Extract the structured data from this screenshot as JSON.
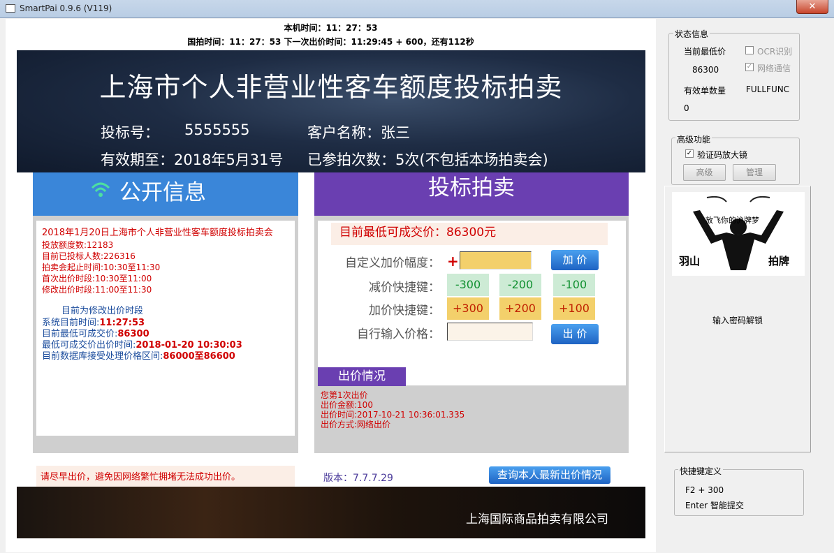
{
  "window": {
    "title": "SmartPai 0.9.6 (V119)",
    "close_label": "✕"
  },
  "header": {
    "local_time": "本机时间：11：27：53",
    "auction_time": "国拍时间：11：27：53 下一次出价时间：11:29:45 + 600，还有112秒"
  },
  "banner": {
    "title": "上海市个人非营业性客车额度投标拍卖",
    "bid_no_label": "投标号：",
    "bid_no": "5555555",
    "customer": "客户名称：张三",
    "valid_until": "有效期至：2018年5月31号",
    "participated": "已参拍次数：5次(不包括本场拍卖会)"
  },
  "public_info": {
    "title": "公开信息",
    "lines_red": [
      "2018年1月20日上海市个人非营业性客车额度投标拍卖会",
      "投放额度数:12183",
      "目前已投标人数:226316",
      "拍卖会起止时间:10:30至11:30",
      "首次出价时段:10:30至11:00",
      "修改出价时段:11:00至11:30"
    ],
    "phase": "目前为修改出价时段",
    "sys_time_label": "系统目前时间:",
    "sys_time": "11:27:53",
    "lowest_label": "目前最低可成交价:",
    "lowest": "86300",
    "lowest_time_label": "最低可成交价出价时间:",
    "lowest_time": "2018-01-20 10:30:03",
    "range_label": "目前数据库接受处理价格区间:",
    "range": "86000至86600",
    "warning": "请尽早出价，避免因网络繁忙拥堵无法成功出价。"
  },
  "bidding": {
    "title": "投标拍卖",
    "lowest_price": "目前最低可成交价：86300元",
    "custom_increase_label": "自定义加价幅度：",
    "plus_sign": "+",
    "add_price_btn": "加 价",
    "decrease_label": "减价快捷键：",
    "decrease": [
      "-300",
      "-200",
      "-100"
    ],
    "increase_label": "加价快捷键：",
    "increase": [
      "+300",
      "+200",
      "+100"
    ],
    "manual_label": "自行输入价格：",
    "submit_btn": "出 价",
    "status_tab": "出价情况",
    "status_lines": [
      "您第1次出价",
      "出价金额:100",
      "出价时间:2017-10-21 10:36:01.335",
      "出价方式:网络出价"
    ],
    "version": "版本：7.7.7.29",
    "query_btn": "查询本人最新出价情况"
  },
  "footer": {
    "company": "上海国际商品拍卖有限公司"
  },
  "sidebar": {
    "status_group": "状态信息",
    "cur_lowest_label": "当前最低价",
    "cur_lowest": "86300",
    "ocr_label": "OCR识别",
    "net_label": "网络通信",
    "valid_count_label": "有效单数量",
    "valid_count": "0",
    "mode": "FULLFUNC",
    "advanced_group": "高级功能",
    "captcha_zoom": "验证码放大镜",
    "advanced_btn": "高级",
    "manage_btn": "管理",
    "logo_slogan": "放飞你的沪牌梦",
    "logo_left": "羽山",
    "logo_right": "拍牌",
    "unlock_text": "输入密码解锁",
    "hotkey_group": "快捷键定义",
    "hotkey1": "F2 + 300",
    "hotkey2": "Enter 智能提交"
  }
}
